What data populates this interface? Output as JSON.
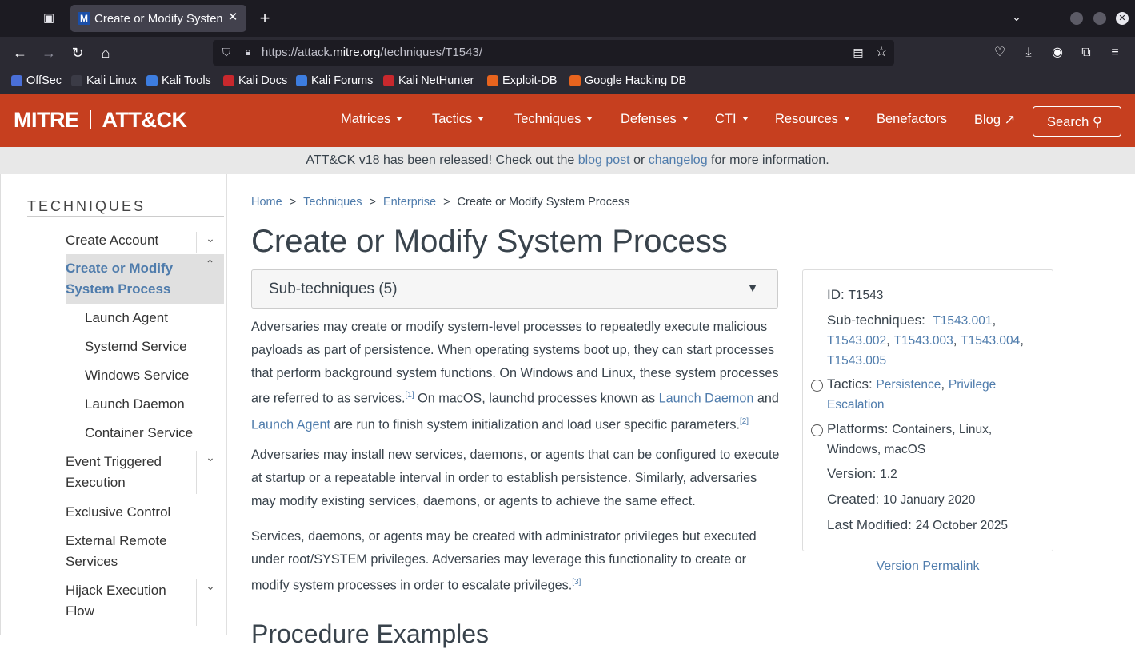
{
  "browser": {
    "tab_title": "Create or Modify System Process",
    "url_prefix": "https://attack.",
    "url_domain": "mitre.org",
    "url_path": "/techniques/T1543/",
    "bookmarks": [
      "OffSec",
      "Kali Linux",
      "Kali Tools",
      "Kali Docs",
      "Kali Forums",
      "Kali NetHunter",
      "Exploit-DB",
      "Google Hacking DB"
    ]
  },
  "header": {
    "logo_left": "MITRE",
    "logo_right": "ATT&CK",
    "nav": [
      "Matrices",
      "Tactics",
      "Techniques",
      "Defenses",
      "CTI",
      "Resources",
      "Benefactors",
      "Blog"
    ],
    "search_label": "Search"
  },
  "banner": {
    "pre": "ATT&CK v18 has been released! Check out the ",
    "link1": "blog post",
    "mid": " or ",
    "link2": "changelog",
    "post": " for more information."
  },
  "sidebar": {
    "title": "TECHNIQUES",
    "items": [
      "Create Account",
      "Create or Modify System Process",
      "Event Triggered Execution",
      "Exclusive Control",
      "External Remote Services",
      "Hijack Execution Flow"
    ],
    "subitems": [
      "Launch Agent",
      "Systemd Service",
      "Windows Service",
      "Launch Daemon",
      "Container Service"
    ]
  },
  "breadcrumb": [
    "Home",
    "Techniques",
    "Enterprise",
    "Create or Modify System Process"
  ],
  "breadcrumb_sep": ">",
  "title": "Create or Modify System Process",
  "subtechniques_label": "Sub-techniques (5)",
  "para1": {
    "a": "Adversaries may create or modify system-level processes to repeatedly execute malicious payloads as part of persistence. When operating systems boot up, they can start processes that perform background system functions. On Windows and Linux, these system processes are referred to as services.",
    "ref1": "[1]",
    "b": " On macOS, launchd processes known as ",
    "link1": "Launch Daemon",
    "c": " and ",
    "link2": "Launch Agent",
    "d": " are run to finish system initialization and load user specific parameters.",
    "ref2": "[2]"
  },
  "para2": "Adversaries may install new services, daemons, or agents that can be configured to execute at startup or a repeatable interval in order to establish persistence. Similarly, adversaries may modify existing services, daemons, or agents to achieve the same effect.",
  "para3": {
    "a": "Services, daemons, or agents may be created with administrator privileges but executed under root/SYSTEM privileges. Adversaries may leverage this functionality to create or modify system processes in order to escalate privileges.",
    "ref": "[3]"
  },
  "procedure_heading": "Procedure Examples",
  "card": {
    "id_label": "ID:",
    "id": "T1543",
    "sub_label": "Sub-techniques:",
    "subs": [
      "T1543.001",
      "T1543.002",
      "T1543.003",
      "T1543.004",
      "T1543.005"
    ],
    "tactics_label": "Tactics:",
    "tactics": [
      "Persistence",
      "Privilege Escalation"
    ],
    "platforms_label": "Platforms:",
    "platforms": "Containers, Linux, Windows, macOS",
    "version_label": "Version:",
    "version": "1.2",
    "created_label": "Created:",
    "created": "10 January 2020",
    "modified_label": "Last Modified:",
    "modified": "24 October 2025"
  },
  "permalink": "Version Permalink",
  "colors": {
    "mitre_red": "#c63f1f",
    "link": "#4f7cac",
    "text": "#39434c"
  }
}
